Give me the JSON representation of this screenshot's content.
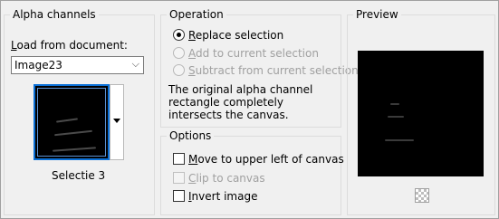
{
  "alpha_channels": {
    "title": "Alpha channels",
    "load_label": "Load from document:",
    "document_value": "Image23",
    "selection_name": "Selectie 3"
  },
  "operation": {
    "title": "Operation",
    "options": [
      {
        "label": "Replace selection",
        "underline": "R",
        "selected": true,
        "enabled": true
      },
      {
        "label": "Add to current selection",
        "underline": "A",
        "selected": false,
        "enabled": false
      },
      {
        "label": "Subtract from current selection",
        "underline": "S",
        "selected": false,
        "enabled": false
      }
    ],
    "info": "The original alpha channel rectangle completely intersects the canvas."
  },
  "options": {
    "title": "Options",
    "checkboxes": [
      {
        "label": "Move to upper left of canvas",
        "underline": "M",
        "checked": false,
        "enabled": true
      },
      {
        "label": "Clip to canvas",
        "underline": "C",
        "checked": false,
        "enabled": false
      },
      {
        "label": "Invert image",
        "underline": "I",
        "checked": false,
        "enabled": true
      }
    ]
  },
  "preview": {
    "title": "Preview"
  },
  "icons": {
    "dropdown": "chevron-down-icon",
    "transparency": "checkerboard-icon"
  }
}
